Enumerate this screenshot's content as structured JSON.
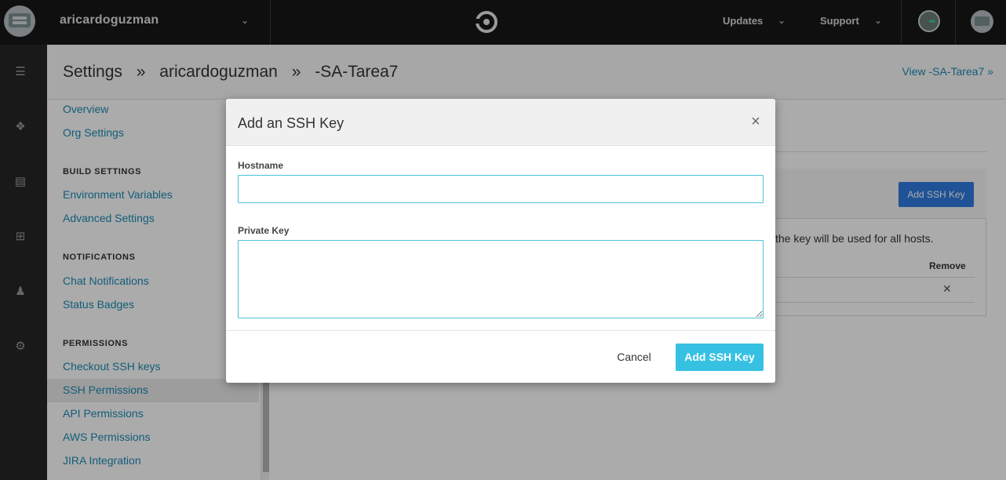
{
  "topbar": {
    "org_name": "aricardoguzman",
    "updates_label": "Updates",
    "support_label": "Support"
  },
  "rail": {
    "icons": [
      "builds-icon",
      "workflows-icon",
      "insights-icon",
      "add-projects-icon",
      "team-icon",
      "settings-icon"
    ]
  },
  "header": {
    "crumb_root": "Settings",
    "separator": "»",
    "crumb_org": "aricardoguzman",
    "crumb_project": "-SA-Tarea7",
    "view_link": "View -SA-Tarea7 »"
  },
  "sidebar": {
    "overview": "Overview",
    "org_settings": "Org Settings",
    "build_settings_head": "BUILD SETTINGS",
    "env_vars": "Environment Variables",
    "advanced": "Advanced Settings",
    "notifications_head": "NOTIFICATIONS",
    "chat": "Chat Notifications",
    "badges": "Status Badges",
    "permissions_head": "PERMISSIONS",
    "checkout_keys": "Checkout SSH keys",
    "ssh_permissions": "SSH Permissions",
    "api_permissions": "API Permissions",
    "aws_permissions": "AWS Permissions",
    "jira": "JIRA Integration"
  },
  "panel": {
    "add_button": "Add SSH Key",
    "text": "the key will be used for all hosts.",
    "col_remove": "Remove",
    "remove_x": "✕"
  },
  "modal": {
    "title": "Add an SSH Key",
    "close": "×",
    "hostname_label": "Hostname",
    "hostname_value": "",
    "private_key_label": "Private Key",
    "private_key_value": "",
    "cancel_label": "Cancel",
    "submit_label": "Add SSH Key"
  },
  "colors": {
    "accent": "#36c1e2",
    "input_border": "#4cc3d9",
    "link": "#1a8bb5",
    "topbar": "#171717"
  }
}
